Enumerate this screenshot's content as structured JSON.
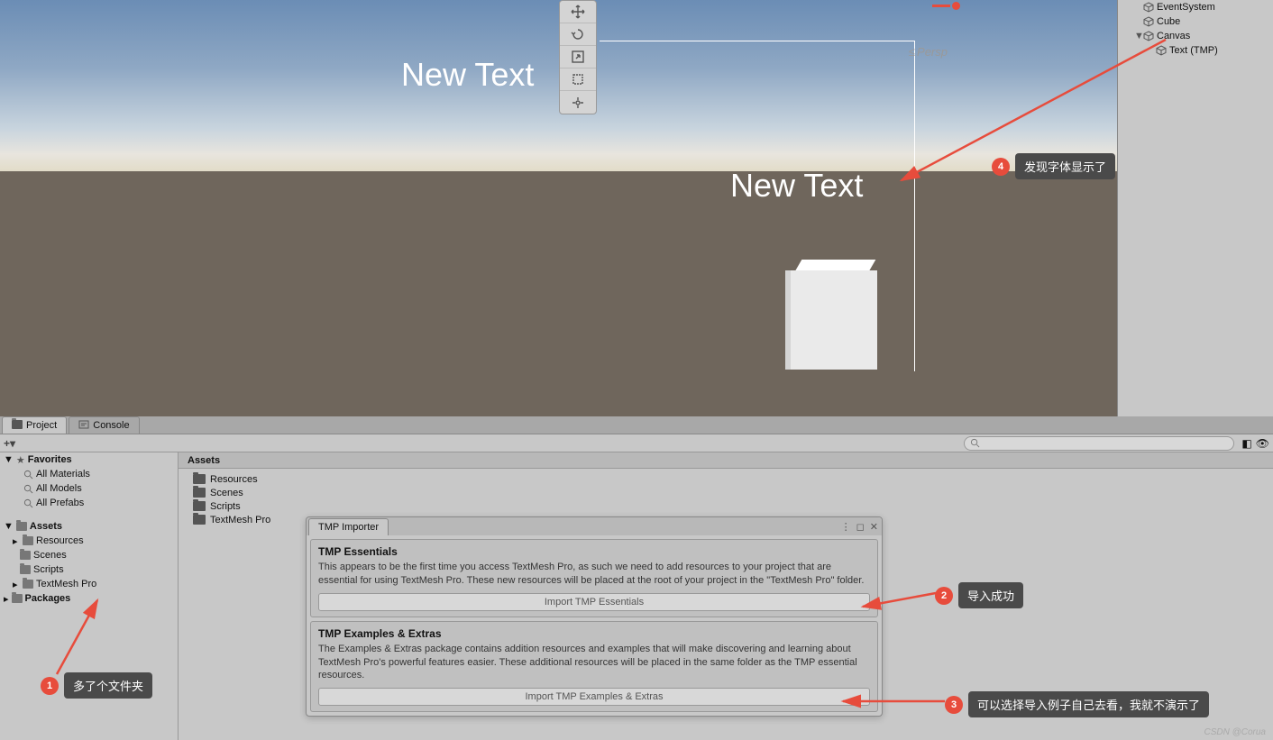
{
  "scene": {
    "text1": "New Text",
    "text2": "New Text",
    "persp": "Persp"
  },
  "hierarchy": {
    "items": [
      {
        "label": "EventSystem",
        "indent": 1,
        "arrow": ""
      },
      {
        "label": "Cube",
        "indent": 1,
        "arrow": ""
      },
      {
        "label": "Canvas",
        "indent": 1,
        "arrow": "▼"
      },
      {
        "label": "Text (TMP)",
        "indent": 2,
        "arrow": ""
      }
    ]
  },
  "tabs": {
    "project": "Project",
    "console": "Console"
  },
  "toolbar": {
    "plus": "+▾"
  },
  "favorites": {
    "header": "Favorites",
    "items": [
      "All Materials",
      "All Models",
      "All Prefabs"
    ]
  },
  "assets_tree": {
    "header": "Assets",
    "items": [
      "Resources",
      "Scenes",
      "Scripts",
      "TextMesh Pro"
    ],
    "packages": "Packages"
  },
  "breadcrumb": "Assets",
  "asset_folders": [
    "Resources",
    "Scenes",
    "Scripts",
    "TextMesh Pro"
  ],
  "tmp": {
    "title": "TMP Importer",
    "sec1_title": "TMP Essentials",
    "sec1_body": "This appears to be the first time you access TextMesh Pro, as such we need to add resources to your project that are essential for using TextMesh Pro. These new resources will be placed at the root of your project in the \"TextMesh Pro\" folder.",
    "sec1_btn": "Import TMP Essentials",
    "sec2_title": "TMP Examples & Extras",
    "sec2_body": "The Examples & Extras package contains addition resources and examples that will make discovering and learning about TextMesh Pro's powerful features easier. These additional resources will be placed in the same folder as the TMP essential resources.",
    "sec2_btn": "Import TMP Examples & Extras"
  },
  "callouts": {
    "c1": "多了个文件夹",
    "c2": "导入成功",
    "c3": "可以选择导入例子自己去看，我就不演示了",
    "c4": "发现字体显示了"
  },
  "watermark": "CSDN @Corua"
}
